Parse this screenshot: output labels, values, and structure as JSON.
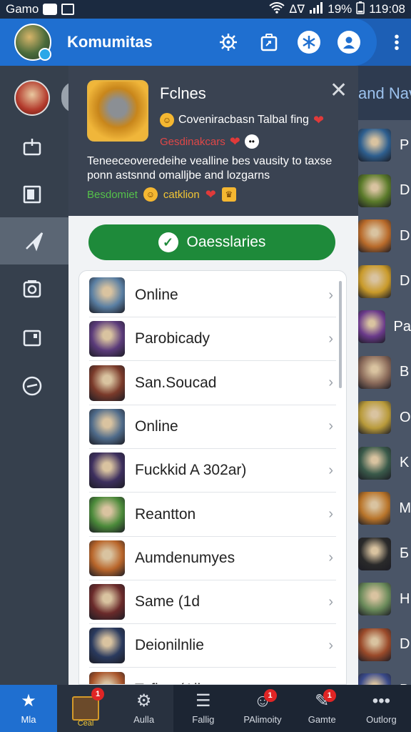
{
  "status_bar": {
    "carrier": "Gamo",
    "battery": "19%",
    "time": "119:08"
  },
  "app_bar": {
    "title": "Komumitas"
  },
  "game_card": {
    "name": "Fclnes",
    "subtitle": "Coveniracbasn Talbal fing",
    "sub2": "Gesdinakcars",
    "description": "Teneeceoveredeihe vealline bes vausity to taxse ponn astsnnd omalljbe and lozgarns",
    "tag1": "Besdomiet",
    "tag2": "catklion"
  },
  "action_button": {
    "label": "Oaesslaries"
  },
  "list": {
    "items": [
      {
        "label": "Online",
        "thumb": "#5a7fa3"
      },
      {
        "label": "Parobicady",
        "thumb": "#5b3b7a"
      },
      {
        "label": "San.Soucad",
        "thumb": "#7a3a2a"
      },
      {
        "label": "Online",
        "thumb": "#4f6b8a"
      },
      {
        "label": "Fuckkid A 302ar)",
        "thumb": "#3d2f5e"
      },
      {
        "label": "Reantton",
        "thumb": "#4b8a3a"
      },
      {
        "label": "Aumdenumyes",
        "thumb": "#b8652a"
      },
      {
        "label": "Same (1d",
        "thumb": "#6a2a2a"
      },
      {
        "label": "Deionilnlie",
        "thumb": "#2a3a5e"
      },
      {
        "label": "Tofino (Allo",
        "thumb": "#a8542a"
      }
    ]
  },
  "background_list": {
    "header": "and Nav",
    "rows": [
      {
        "letter": "P",
        "thumb": "#2e5f8f"
      },
      {
        "letter": "D",
        "thumb": "#5a7a2a"
      },
      {
        "letter": "D",
        "thumb": "#b86a2a"
      },
      {
        "letter": "D",
        "thumb": "#c99a2a"
      },
      {
        "letter": "Pa",
        "thumb": "#6a3a8a"
      },
      {
        "letter": "B",
        "thumb": "#8a6a5a"
      },
      {
        "letter": "O",
        "thumb": "#b89a3a"
      },
      {
        "letter": "K",
        "thumb": "#3a5a4a"
      },
      {
        "letter": "M",
        "thumb": "#b8742a"
      },
      {
        "letter": "Б",
        "thumb": "#2a2a2a"
      },
      {
        "letter": "H",
        "thumb": "#6a8a5a"
      },
      {
        "letter": "D",
        "thumb": "#9a4a2a"
      },
      {
        "letter": "B",
        "thumb": "#3a4a8a"
      }
    ]
  },
  "bottom_nav": {
    "items": [
      {
        "label": "Mla"
      },
      {
        "label": ""
      },
      {
        "label": "Aulla"
      },
      {
        "label": "Fallig"
      },
      {
        "label": "PAlimoity",
        "badge": "1"
      },
      {
        "label": "Gamte",
        "badge": "1"
      },
      {
        "label": "Outlorg"
      }
    ],
    "game_badge": "1",
    "game_caption": "Ceal"
  },
  "colors": {
    "primary": "#1f6fd0",
    "success": "#1e8a3a",
    "rail": "#36404d"
  }
}
